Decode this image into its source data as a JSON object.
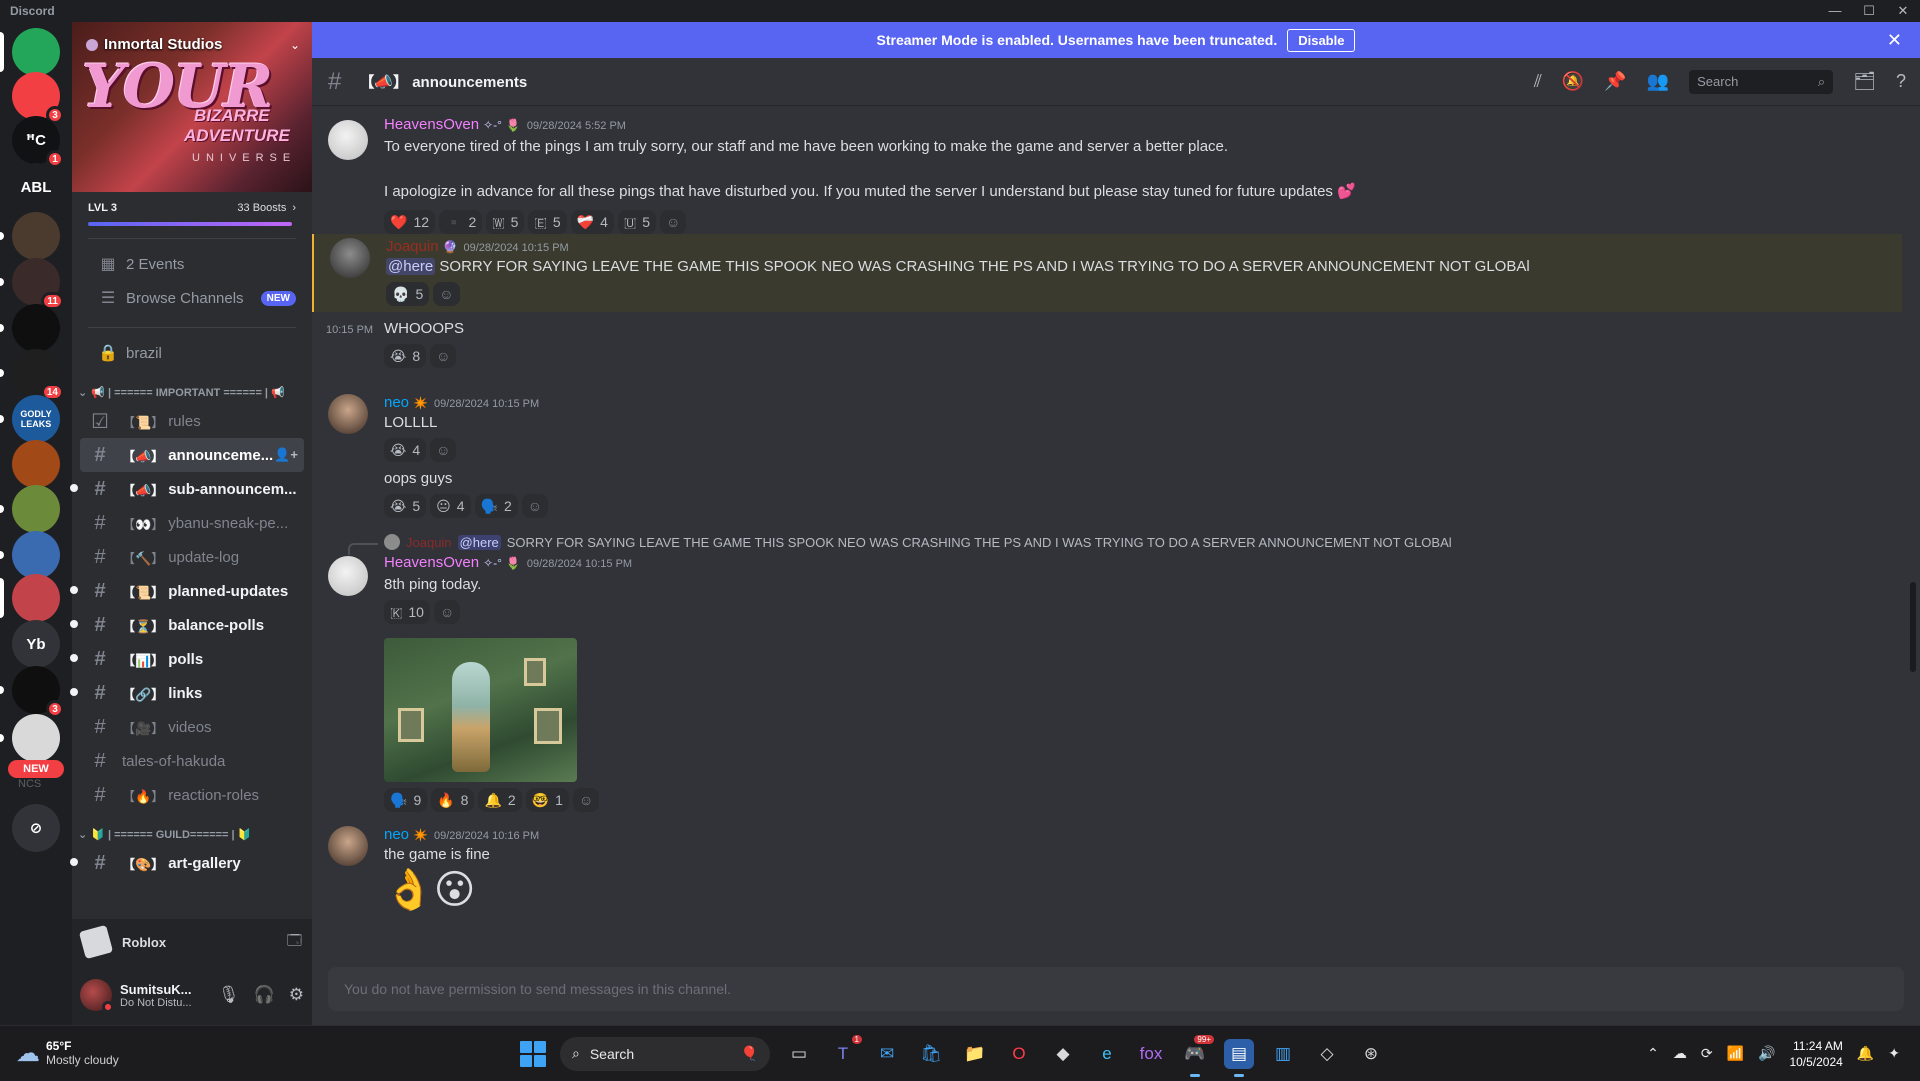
{
  "window": {
    "title": "Discord"
  },
  "guilds": [
    {
      "label": "",
      "badge": "",
      "color": "#23a55a",
      "pip": "tall"
    },
    {
      "label": "",
      "badge": "3",
      "color": "#f23f43",
      "pip": ""
    },
    {
      "label": "ꟸC",
      "badge": "1",
      "color": "#111214",
      "pip": ""
    },
    {
      "label": "ABL",
      "badge": "",
      "color": "#1e1f22",
      "pip": ""
    },
    {
      "label": "",
      "badge": "",
      "color": "#4b3a2e",
      "pip": "dot"
    },
    {
      "label": "",
      "badge": "11",
      "color": "#3a2a2a",
      "pip": "dot"
    },
    {
      "label": "",
      "badge": "",
      "color": "#0f0f0f",
      "pip": "dot"
    },
    {
      "label": "",
      "badge": "14",
      "color": "#1f1f1f",
      "pip": "dot"
    },
    {
      "label": "GODLY LEAKS",
      "badge": "",
      "color": "#1d5a9c",
      "pip": "dot"
    },
    {
      "label": "",
      "badge": "",
      "color": "#a24a17",
      "pip": ""
    },
    {
      "label": "",
      "badge": "",
      "color": "#6b8a3a",
      "pip": "dot"
    },
    {
      "label": "",
      "badge": "",
      "color": "#3a6ab0",
      "pip": "dot"
    },
    {
      "label": "",
      "badge": "",
      "color": "#c2434a",
      "pip": "tall"
    },
    {
      "label": "Yb",
      "badge": "",
      "color": "#313338",
      "pip": ""
    },
    {
      "label": "",
      "badge": "3",
      "color": "#0f0f0f",
      "pip": "dot"
    },
    {
      "label": "",
      "badge": "",
      "color": "#d9d9d9",
      "pip": "dot"
    }
  ],
  "guild_new_pill": "NEW",
  "guild_new_pill_sub": "NCS",
  "server": {
    "name": "Inmortal Studios",
    "banner_title": "YOUR",
    "banner_sub1": "BIZARRE",
    "banner_sub2": "ADVENTURE",
    "banner_sub3": "UNIVERSE",
    "level": "LVL 3",
    "boosts": "33 Boosts",
    "boost_progress": 0.98
  },
  "sidebar_top": [
    {
      "icon": "calendar-icon",
      "label": "2 Events",
      "tag": ""
    },
    {
      "icon": "browse-icon",
      "label": "Browse Channels",
      "tag": "NEW"
    }
  ],
  "locked_channel": "brazil",
  "categories": {
    "important": "📢 | ====== IMPORTANT ====== | 📢",
    "guild": "🔰 | ====== GUILD====== | 🔰"
  },
  "channels_important": [
    {
      "emoji": "【📜】",
      "label": "rules",
      "state": "muted",
      "icon": "☑"
    },
    {
      "emoji": "【📣】",
      "label": "announceme...",
      "state": "active",
      "icon": "#"
    },
    {
      "emoji": "【📣】",
      "label": "sub-announcem...",
      "state": "unread",
      "icon": "#"
    },
    {
      "emoji": "【👀】",
      "label": "ybanu-sneak-pe...",
      "state": "muted",
      "icon": "#"
    },
    {
      "emoji": "【🔨】",
      "label": "update-log",
      "state": "muted",
      "icon": "#"
    },
    {
      "emoji": "【📜】",
      "label": "planned-updates",
      "state": "unread",
      "icon": "#"
    },
    {
      "emoji": "【⏳】",
      "label": "balance-polls",
      "state": "unread",
      "icon": "#"
    },
    {
      "emoji": "【📊】",
      "label": "polls",
      "state": "unread",
      "icon": "#"
    },
    {
      "emoji": "【🔗】",
      "label": "links",
      "state": "unread",
      "icon": "#"
    },
    {
      "emoji": "【🎥】",
      "label": "videos",
      "state": "muted",
      "icon": "#"
    },
    {
      "emoji": "",
      "label": "tales-of-hakuda",
      "state": "muted",
      "icon": "#"
    },
    {
      "emoji": "【🔥】",
      "label": "reaction-roles",
      "state": "muted",
      "icon": "#"
    }
  ],
  "channels_guild": [
    {
      "emoji": "【🎨】",
      "label": "art-gallery",
      "state": "unread",
      "icon": "#"
    }
  ],
  "activity": {
    "game": "Roblox"
  },
  "user": {
    "name": "SumitsuK...",
    "status": "Do Not Distu..."
  },
  "streamer_bar": {
    "text": "Streamer Mode is enabled. Usernames have been truncated.",
    "button": "Disable"
  },
  "channel_header": {
    "title": "【📣】 announcements",
    "search_placeholder": "Search"
  },
  "messages": [
    {
      "author": "HeavensOven",
      "author_color": "#f47fff",
      "badge": "✧-°",
      "time": "09/28/2024 5:52 PM",
      "lines": [
        "To everyone tired of the pings I am truly sorry, our staff and me have been working to make the game and server a better place.",
        "I apologize in advance for all these pings that have disturbed you. If you muted the server I understand but please stay tuned for future updates 💕"
      ],
      "reactions": [
        [
          "❤️",
          "12"
        ],
        [
          "▪️",
          "2"
        ],
        [
          "🇼",
          "5"
        ],
        [
          "🇪",
          "5"
        ],
        [
          "❤️‍🩹",
          "4"
        ],
        [
          "🇺",
          "5"
        ]
      ]
    },
    {
      "author": "Joaquin",
      "author_color": "#992d22",
      "badge": "",
      "time": "09/28/2024 10:15 PM",
      "mention": "@here",
      "text": "SORRY FOR SAYING LEAVE THE GAME THIS SPOOK NEO WAS CRASHING THE PS AND I WAS TRYING TO DO A SERVER ANNOUNCEMENT NOT GLOBAl",
      "reactions": [
        [
          "💀",
          "5"
        ]
      ]
    },
    {
      "side_time": "10:15 PM",
      "text": "WHOOOPS",
      "reactions": [
        [
          "😭",
          "8"
        ]
      ]
    },
    {
      "author": "neo",
      "author_color": "#00a8fc",
      "badge": "",
      "time": "09/28/2024 10:15 PM",
      "text": "LOLLLL",
      "reactions": [
        [
          "😭",
          "4"
        ]
      ],
      "text2": "oops guys",
      "reactions2": [
        [
          "😭",
          "5"
        ],
        [
          "😐",
          "4"
        ],
        [
          "🗣️",
          "2"
        ]
      ]
    },
    {
      "reply_name": "Joaquin",
      "reply_mention": "@here",
      "reply_text": "SORRY FOR SAYING LEAVE THE GAME THIS SPOOK NEO WAS CRASHING THE PS AND I WAS TRYING TO DO A SERVER ANNOUNCEMENT NOT GLOBAl",
      "author": "HeavensOven",
      "author_color": "#f47fff",
      "badge": "✧-°",
      "time": "09/28/2024 10:15 PM",
      "text": "8th ping today.",
      "reactions": [
        [
          "🇰",
          "10"
        ]
      ],
      "reactions2": [
        [
          "🗣️",
          "9"
        ],
        [
          "🔥",
          "8"
        ],
        [
          "🔔",
          "2"
        ],
        [
          "🤓",
          "1"
        ]
      ]
    },
    {
      "author": "neo",
      "author_color": "#00a8fc",
      "badge": "",
      "time": "09/28/2024 10:16 PM",
      "text": "the game is fine",
      "sticker": "👌😮"
    }
  ],
  "composer": {
    "placeholder": "You do not have permission to send messages in this channel."
  },
  "taskbar": {
    "temp": "65°F",
    "condition": "Mostly cloudy",
    "search": "Search",
    "time": "11:24 AM",
    "date": "10/5/2024",
    "discord_badge": "99+",
    "teams_badge": "1"
  }
}
